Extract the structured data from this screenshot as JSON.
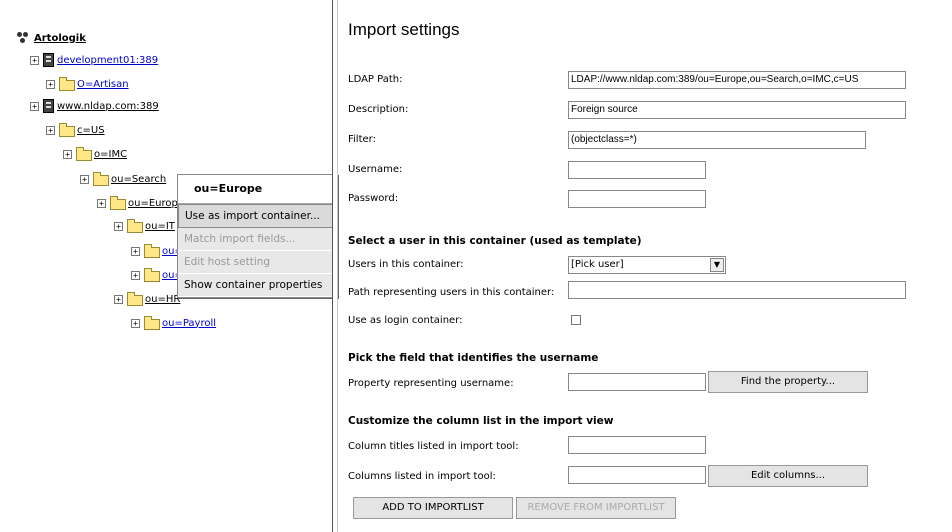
{
  "tree": {
    "root": "Artologik",
    "nodes": [
      {
        "label": "development01:389",
        "type": "server",
        "color": "link"
      },
      {
        "label": "O=Artisan",
        "type": "folder",
        "color": "link"
      },
      {
        "label": "www.nldap.com:389",
        "type": "server",
        "color": "dark"
      },
      {
        "label": "c=US",
        "type": "folder",
        "color": "dark"
      },
      {
        "label": "o=IMC",
        "type": "folder",
        "color": "dark"
      },
      {
        "label": "ou=Search",
        "type": "folder",
        "color": "dark"
      },
      {
        "label": "ou=Europ",
        "type": "folder",
        "color": "dark"
      },
      {
        "label": "ou=IT",
        "type": "folder",
        "color": "dark"
      },
      {
        "label": "ou=",
        "type": "folder",
        "color": "link"
      },
      {
        "label": "ou=",
        "type": "folder",
        "color": "link"
      },
      {
        "label": "ou=HR",
        "type": "folder",
        "color": "dark"
      },
      {
        "label": "ou=Payroll",
        "type": "folder",
        "color": "link"
      }
    ],
    "expander": "+"
  },
  "context_menu": {
    "title": "ou=Europe",
    "items": [
      {
        "label": "Use as import container...",
        "disabled": false
      },
      {
        "label": "Match import fields...",
        "disabled": true
      },
      {
        "label": "Edit host setting",
        "disabled": true
      },
      {
        "label": "Show container properties",
        "disabled": false
      }
    ]
  },
  "form": {
    "title": "Import settings",
    "ldap_path_label": "LDAP Path:",
    "ldap_path_value": "LDAP://www.nldap.com:389/ou=Europe,ou=Search,o=IMC,c=US",
    "description_label": "Description:",
    "description_value": "Foreign source",
    "filter_label": "Filter:",
    "filter_value": "(objectclass=*)",
    "username_label": "Username:",
    "username_value": "",
    "password_label": "Password:",
    "password_value": "",
    "section_user": "Select a user in this container (used as template)",
    "users_label": "Users in this container:",
    "users_selected": "[Pick user]",
    "path_users_label": "Path representing users in this container:",
    "path_users_value": "",
    "login_container_label": "Use as login container:",
    "login_container_checked": false,
    "section_username": "Pick the field that identifies the username",
    "property_label": "Property representing username:",
    "property_value": "",
    "find_property_button": "Find the property...",
    "section_columns": "Customize the column list in the import view",
    "col_titles_label": "Column titles listed in import tool:",
    "col_titles_value": "",
    "cols_label": "Columns listed in import tool:",
    "cols_value": "",
    "edit_columns_button": "Edit columns...",
    "add_button": "ADD TO IMPORTLIST",
    "remove_button": "REMOVE FROM IMPORTLIST"
  }
}
